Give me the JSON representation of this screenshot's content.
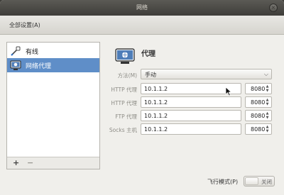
{
  "window": {
    "title": "网络",
    "close_glyph": "×"
  },
  "toolbar": {
    "all_settings_label": "全部设置(A)"
  },
  "sidebar": {
    "items": [
      {
        "label": "有线",
        "icon": "wired-icon",
        "selected": false
      },
      {
        "label": "网络代理",
        "icon": "network-proxy-icon",
        "selected": true
      }
    ],
    "add_label": "+",
    "remove_label": "−"
  },
  "panel": {
    "title": "代理",
    "icon": "network-proxy-icon",
    "method": {
      "label": "方法(M)",
      "value": "手动",
      "arrow": "⌵"
    },
    "rows": [
      {
        "label": "HTTP 代理",
        "host": "10.1.1.2",
        "port": "8080"
      },
      {
        "label": "HTTP 代理",
        "host": "10.1.1.2",
        "port": "8080"
      },
      {
        "label": "FTP 代理",
        "host": "10.1.1.2",
        "port": "8080"
      },
      {
        "label": "Socks 主机",
        "host": "10.1.1.2",
        "port": "8080"
      }
    ],
    "spin_up": "▲",
    "spin_down": "▼"
  },
  "airplane_mode": {
    "label": "飞行模式(P)",
    "state": "关闭"
  },
  "colors": {
    "selected": "#5f8ec8",
    "titlebar": "#3e3d39",
    "background": "#f0efeb"
  }
}
